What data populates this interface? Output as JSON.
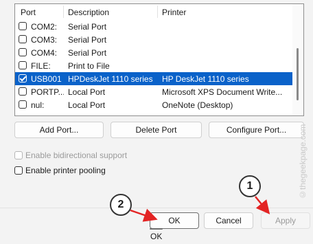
{
  "columns": {
    "port": "Port",
    "description": "Description",
    "printer": "Printer"
  },
  "ports": [
    {
      "port": "COM2:",
      "description": "Serial Port",
      "printer": "",
      "checked": false,
      "selected": false
    },
    {
      "port": "COM3:",
      "description": "Serial Port",
      "printer": "",
      "checked": false,
      "selected": false
    },
    {
      "port": "COM4:",
      "description": "Serial Port",
      "printer": "",
      "checked": false,
      "selected": false
    },
    {
      "port": "FILE:",
      "description": "Print to File",
      "printer": "",
      "checked": false,
      "selected": false
    },
    {
      "port": "USB001",
      "description": "HPDeskJet 1110 series",
      "printer": "HP DeskJet 1110 series",
      "checked": true,
      "selected": true
    },
    {
      "port": "PORTP...",
      "description": "Local Port",
      "printer": "Microsoft XPS Document Write...",
      "checked": false,
      "selected": false
    },
    {
      "port": "nul:",
      "description": "Local Port",
      "printer": "OneNote (Desktop)",
      "checked": false,
      "selected": false
    }
  ],
  "buttons": {
    "add_port": "Add Port...",
    "delete_port": "Delete Port",
    "configure_port": "Configure Port...",
    "ok": "OK",
    "cancel": "Cancel",
    "apply": "Apply"
  },
  "options": {
    "bidirectional": "Enable bidirectional support",
    "pooling": "Enable printer pooling"
  },
  "annotations": {
    "badge1": "1",
    "badge2": "2"
  },
  "watermark": "©thegeekpage.com",
  "colors": {
    "selection": "#0a62c9",
    "arrow": "#e32424"
  }
}
